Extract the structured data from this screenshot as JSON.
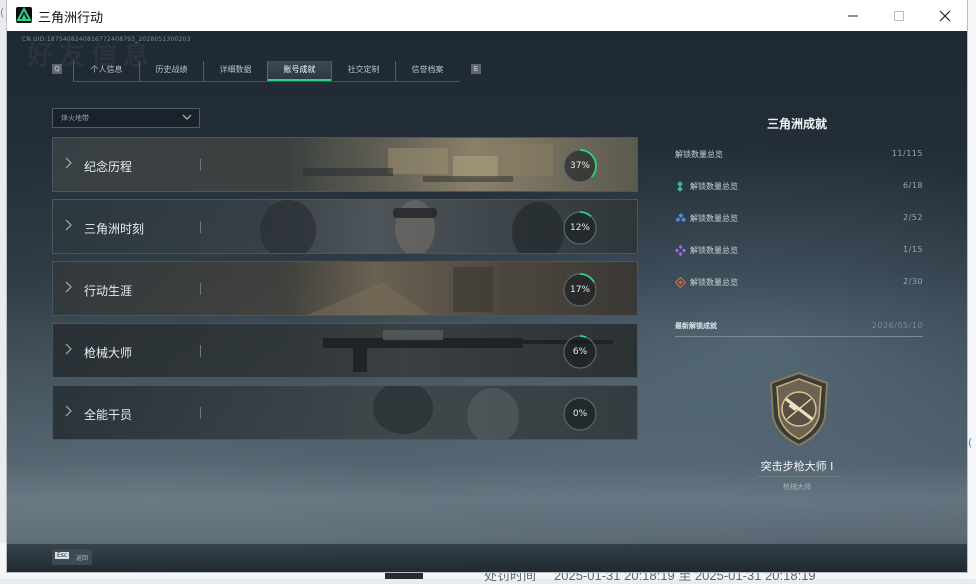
{
  "window": {
    "title": "三角洲行动"
  },
  "uid": "CN UID:1875408240816772408793_2028051300203",
  "watermark": "好友信息",
  "nav": {
    "left_key": "Q",
    "right_key": "E",
    "tabs": [
      {
        "label": "个人信息"
      },
      {
        "label": "历史战绩"
      },
      {
        "label": "详细数据"
      },
      {
        "label": "账号成就",
        "active": true
      },
      {
        "label": "社交定制"
      },
      {
        "label": "信誉档案"
      }
    ]
  },
  "filter": {
    "label": "烽火地带"
  },
  "categories": [
    {
      "title": "纪念历程",
      "progress": 37,
      "progress_label": "37%"
    },
    {
      "title": "三角洲时刻",
      "progress": 12,
      "progress_label": "12%"
    },
    {
      "title": "行动生涯",
      "progress": 17,
      "progress_label": "17%"
    },
    {
      "title": "枪械大师",
      "progress": 6,
      "progress_label": "6%"
    },
    {
      "title": "全能干员",
      "progress": 0,
      "progress_label": "0%"
    }
  ],
  "panel": {
    "title": "三角洲成就",
    "total": {
      "label": "解锁数量总览",
      "value": "11/115"
    },
    "tiers": [
      {
        "icon": "teal-tier-icon",
        "color": "#3fb8a0",
        "label": "解锁数量总览",
        "value": "6/18"
      },
      {
        "icon": "blue-tier-icon",
        "color": "#4a8fd8",
        "label": "解锁数量总览",
        "value": "2/52"
      },
      {
        "icon": "purple-tier-icon",
        "color": "#9a6cd8",
        "label": "解锁数量总览",
        "value": "1/15"
      },
      {
        "icon": "orange-tier-icon",
        "color": "#d86a3a",
        "label": "解锁数量总览",
        "value": "2/30"
      }
    ],
    "recent": {
      "label": "最新解锁成就",
      "date": "2026/05/10"
    },
    "badge": {
      "name": "突击步枪大师 I",
      "category": "枪械大师"
    }
  },
  "bottom": {
    "key": "Esc",
    "label": "返回"
  },
  "desktop": {
    "left_label": "处罚时间",
    "time_range": "2025-01-31 20:18:19 至 2025-01-31 20:18:19"
  },
  "colors": {
    "accent": "#2fd18a",
    "ring": "#2fd18a"
  }
}
